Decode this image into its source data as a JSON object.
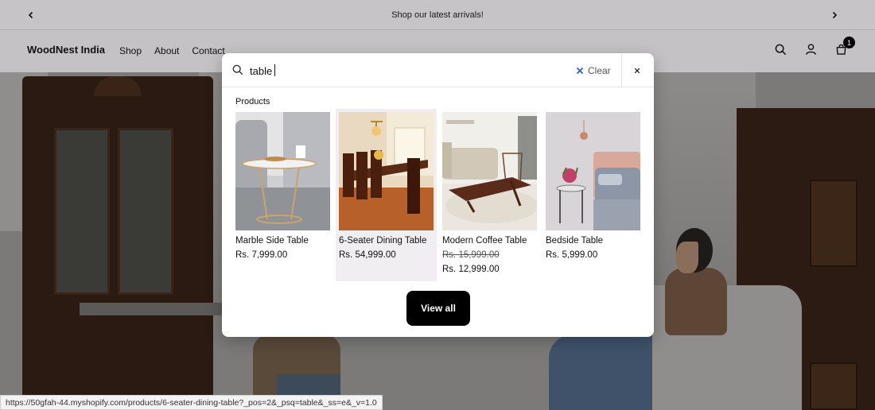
{
  "announcement": {
    "text": "Shop our latest arrivals!"
  },
  "header": {
    "logo": "WoodNest India",
    "nav": [
      "Shop",
      "About",
      "Contact"
    ],
    "cart_count": "1"
  },
  "search": {
    "query": "table",
    "clear_label": "Clear",
    "section_title": "Products",
    "view_all_label": "View all",
    "products": [
      {
        "name": "Marble Side Table",
        "price": "Rs. 7,999.00"
      },
      {
        "name": "6-Seater Dining Table",
        "price": "Rs. 54,999.00"
      },
      {
        "name": "Modern Coffee Table",
        "compare_price": "Rs. 15,999.00",
        "price": "Rs. 12,999.00"
      },
      {
        "name": "Bedside Table",
        "price": "Rs. 5,999.00"
      }
    ]
  },
  "status_url": "https://50gfah-44.myshopify.com/products/6-seater-dining-table?_pos=2&_psq=table&_ss=e&_v=1.0",
  "icons": {
    "prev": "chevron-left-icon",
    "next": "chevron-right-icon",
    "search": "search-icon",
    "account": "user-icon",
    "cart": "cart-icon",
    "clear": "x-icon",
    "close": "close-icon"
  },
  "colors": {
    "highlight": "#f1eef2",
    "button": "#000000",
    "clear_x": "#2b5bd7"
  }
}
